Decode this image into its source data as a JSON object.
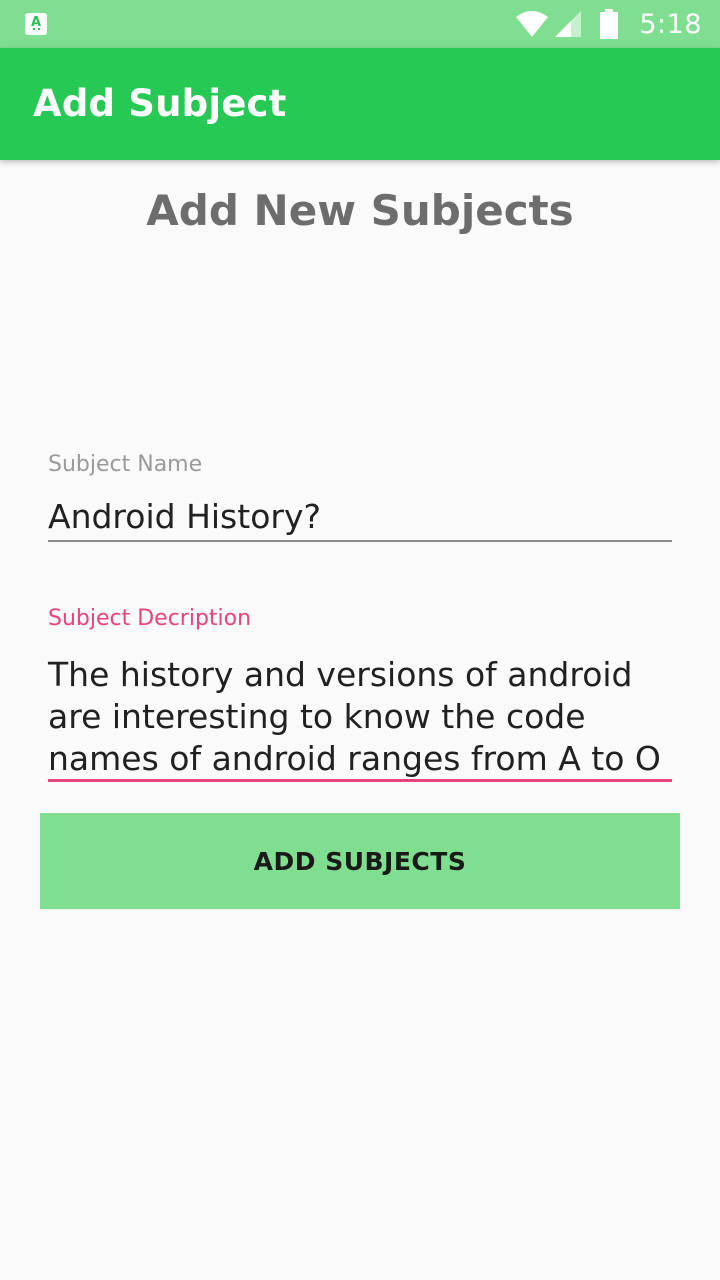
{
  "status_bar": {
    "app_icon": "android-app-icon",
    "app_icon_letter": "A",
    "icons": [
      "wifi-icon",
      "signal-icon",
      "battery-icon"
    ],
    "time": "5:18"
  },
  "app_bar": {
    "title": "Add Subject"
  },
  "form": {
    "heading": "Add New Subjects",
    "subject_name_label": "Subject Name",
    "subject_name_value": "Android History?",
    "subject_description_label": "Subject Decription",
    "subject_description_value": "The history and versions of android are interesting to know the code names of android ranges from A to O",
    "add_button_label": "ADD SUBJECTS"
  },
  "colors": {
    "status_bar": "#80de91",
    "app_bar": "#26c954",
    "accent": "#e8437f",
    "button": "#80de91",
    "background": "#fafafa"
  }
}
